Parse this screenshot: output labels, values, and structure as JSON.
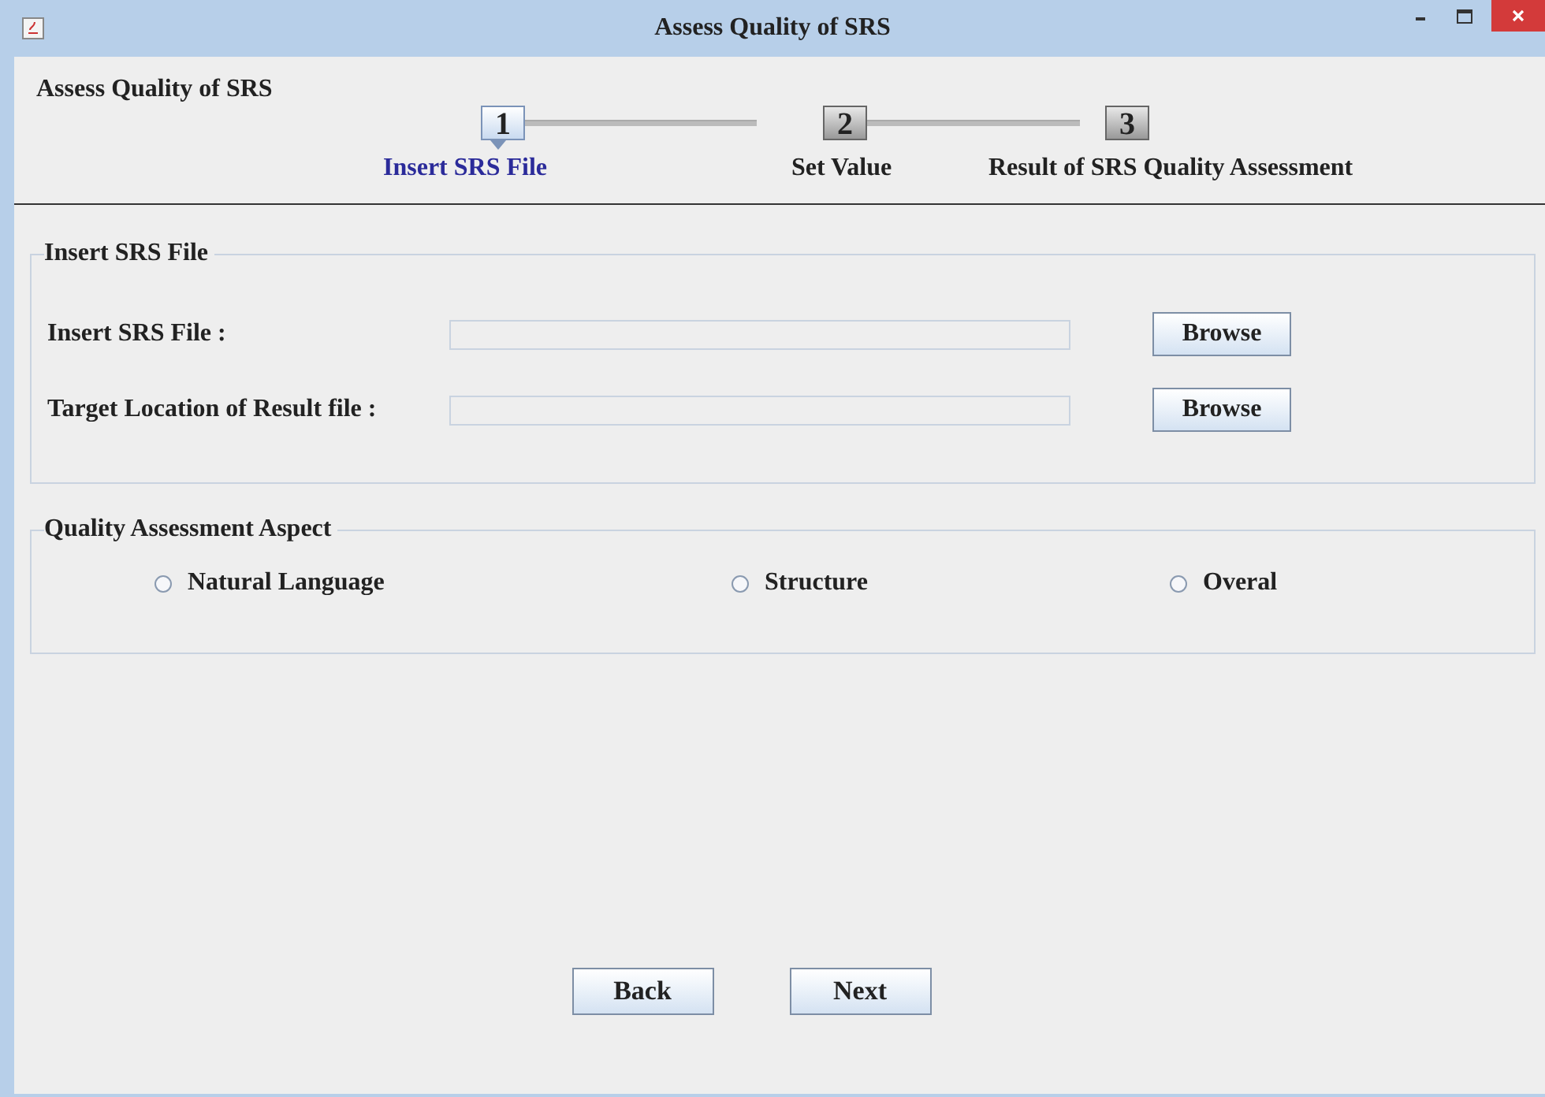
{
  "window": {
    "title": "Assess Quality of SRS"
  },
  "header": {
    "title": "Assess Quality of SRS"
  },
  "steps": [
    {
      "number": "1",
      "label": "Insert SRS File",
      "selected": true
    },
    {
      "number": "2",
      "label": "Set Value",
      "selected": false
    },
    {
      "number": "3",
      "label": "Result of SRS Quality Assessment",
      "selected": false
    }
  ],
  "file_panel": {
    "title": "Insert SRS File",
    "rows": [
      {
        "label": "Insert SRS File :",
        "button": "Browse"
      },
      {
        "label": "Target Location of Result file :",
        "button": "Browse"
      }
    ]
  },
  "aspect_panel": {
    "title": "Quality Assessment Aspect",
    "options": [
      {
        "label": "Natural Language",
        "selected": false
      },
      {
        "label": "Structure",
        "selected": false
      },
      {
        "label": "Overal",
        "selected": false
      }
    ]
  },
  "buttons": [
    "Back",
    "Next"
  ]
}
